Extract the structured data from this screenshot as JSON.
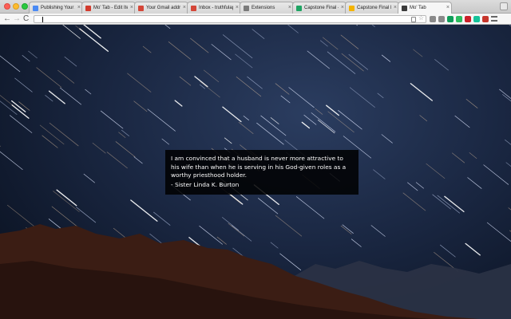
{
  "browser": {
    "tabs": [
      {
        "title": "Publishing Your Ap",
        "favicon": "chrome-web-store-icon",
        "favicon_color": "#4a8af4",
        "active": false
      },
      {
        "title": "Mo' Tab - Edit Item",
        "favicon": "mo-tab-icon",
        "favicon_color": "#d23b2e",
        "active": false
      },
      {
        "title": "Your Gmail address",
        "favicon": "gmail-icon",
        "favicon_color": "#d44638",
        "active": false
      },
      {
        "title": "Inbox - truthfulappr",
        "favicon": "gmail-icon",
        "favicon_color": "#d44638",
        "active": false
      },
      {
        "title": "Extensions",
        "favicon": "puzzle-icon",
        "favicon_color": "#7a7a7a",
        "active": false
      },
      {
        "title": "Capstone Final - G",
        "favicon": "google-drive-icon",
        "favicon_color": "#1fa463",
        "active": false
      },
      {
        "title": "Capstone Final Proj",
        "favicon": "google-slides-icon",
        "favicon_color": "#f4b400",
        "active": false
      },
      {
        "title": "Mo' Tab",
        "favicon": "mo-tab-icon",
        "favicon_color": "#3a3a3a",
        "active": true
      }
    ],
    "close_glyph": "×",
    "nav": {
      "back": "←",
      "forward": "→",
      "reload": "C"
    },
    "address_bar": {
      "value": ""
    },
    "extensions": [
      {
        "name": "reader-mode-icon",
        "color": "#8a8a8a"
      },
      {
        "name": "cast-icon",
        "color": "#8a8a8a"
      },
      {
        "name": "hangouts-icon",
        "color": "#0f9d58"
      },
      {
        "name": "evernote-icon",
        "color": "#2dbe60"
      },
      {
        "name": "lastpass-icon",
        "color": "#cc2029"
      },
      {
        "name": "grammarly-icon",
        "color": "#15c39a"
      },
      {
        "name": "adblock-icon",
        "color": "#c7362c"
      },
      {
        "name": "menu-icon",
        "color": "#666666"
      }
    ]
  },
  "quote": {
    "text": "I am convinced that a husband is never more attractive to his wife than when he is serving in his God-given roles as a worthy priesthood holder.",
    "author": "- Sister Linda K. Burton"
  },
  "colors": {
    "sky_top": "#2b3d60",
    "sky_bottom": "#08101d",
    "mountain_near": "#3b1d14",
    "mountain_far": "#2a3245",
    "quote_box": "#000000"
  }
}
